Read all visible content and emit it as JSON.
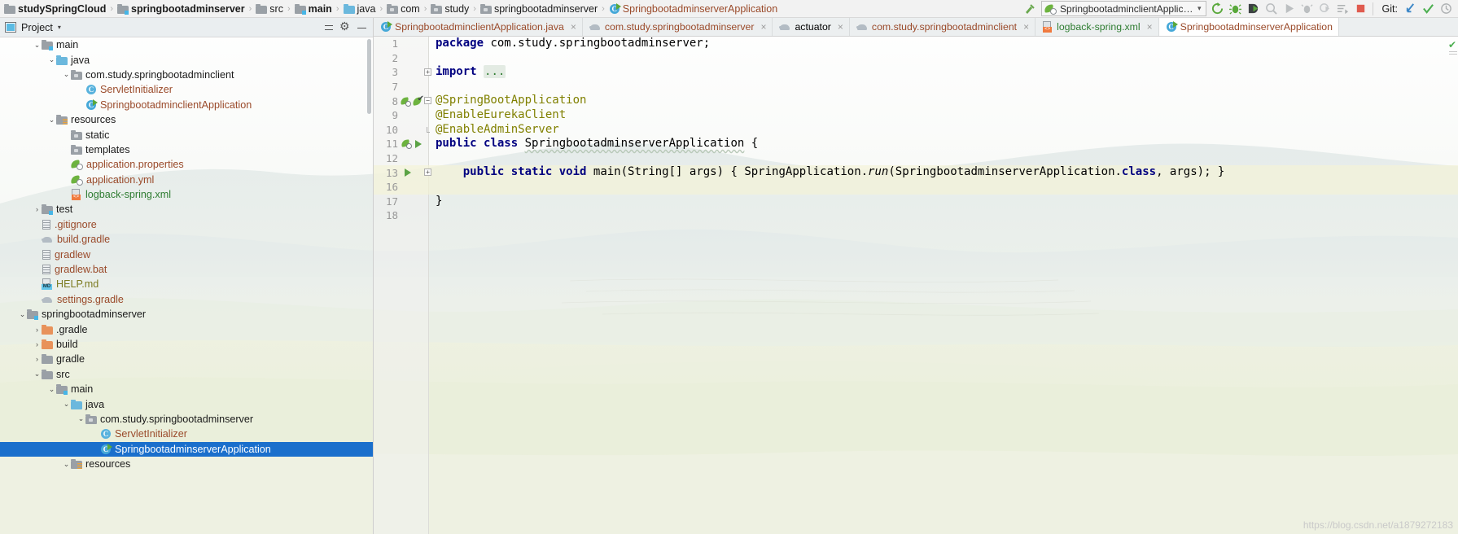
{
  "navbar": {
    "breadcrumbs": [
      {
        "label": "studySpringCloud",
        "icon": "project-icon",
        "style": "bold"
      },
      {
        "label": "springbootadminserver",
        "icon": "module-folder-icon",
        "style": "bold"
      },
      {
        "label": "src",
        "icon": "folder-icon",
        "style": "normal"
      },
      {
        "label": "main",
        "icon": "source-folder-icon",
        "style": "bold"
      },
      {
        "label": "java",
        "icon": "java-folder-icon",
        "style": "normal"
      },
      {
        "label": "com",
        "icon": "package-icon",
        "style": "normal"
      },
      {
        "label": "study",
        "icon": "package-icon",
        "style": "normal"
      },
      {
        "label": "springbootadminserver",
        "icon": "package-icon",
        "style": "normal"
      },
      {
        "label": "SpringbootadminserverApplication",
        "icon": "spring-class-icon",
        "style": "class"
      }
    ],
    "separator": "›",
    "build_icon": "hammer-icon",
    "run_config": {
      "icon": "spring-boot-icon",
      "label": "SpringbootadminclientApplication",
      "chevron": "▾"
    },
    "toolbar_icons": [
      "rerun-icon",
      "debug-icon",
      "run-with-coverage-icon",
      "profile-icon",
      "run-icon",
      "attach-icon",
      "coverage-icon",
      "run-dashboard-icon",
      "stop-icon"
    ],
    "git_label": "Git:",
    "git_icons": [
      "update-project-icon",
      "commit-icon",
      "history-icon"
    ]
  },
  "sidebar": {
    "title": "Project",
    "caret": "▾",
    "header_icons": [
      "collapse-all-icon",
      "settings-gear-icon",
      "hide-icon"
    ],
    "tree": [
      {
        "depth": 2,
        "arrow": "⌄",
        "icon": "source-folder-icon",
        "label": "main",
        "color": "default"
      },
      {
        "depth": 3,
        "arrow": "⌄",
        "icon": "java-folder-icon",
        "label": "java",
        "color": "default"
      },
      {
        "depth": 4,
        "arrow": "⌄",
        "icon": "package-icon",
        "label": "com.study.springbootadminclient",
        "color": "default"
      },
      {
        "depth": 5,
        "arrow": "",
        "icon": "class-icon",
        "label": "ServletInitializer",
        "color": "java"
      },
      {
        "depth": 5,
        "arrow": "",
        "icon": "spring-class-icon",
        "label": "SpringbootadminclientApplication",
        "color": "java"
      },
      {
        "depth": 3,
        "arrow": "⌄",
        "icon": "resources-folder-icon",
        "label": "resources",
        "color": "default"
      },
      {
        "depth": 4,
        "arrow": "",
        "icon": "package-icon",
        "label": "static",
        "color": "default"
      },
      {
        "depth": 4,
        "arrow": "",
        "icon": "package-icon",
        "label": "templates",
        "color": "default"
      },
      {
        "depth": 4,
        "arrow": "",
        "icon": "spring-config-icon",
        "label": "application.properties",
        "color": "java"
      },
      {
        "depth": 4,
        "arrow": "",
        "icon": "spring-config-icon",
        "label": "application.yml",
        "color": "java"
      },
      {
        "depth": 4,
        "arrow": "",
        "icon": "xml-file-icon",
        "label": "logback-spring.xml",
        "color": "green"
      },
      {
        "depth": 2,
        "arrow": "›",
        "icon": "test-folder-icon",
        "label": "test",
        "color": "default"
      },
      {
        "depth": 2,
        "arrow": "",
        "icon": "file-icon",
        "label": ".gitignore",
        "color": "java"
      },
      {
        "depth": 2,
        "arrow": "",
        "icon": "gradle-icon",
        "label": "build.gradle",
        "color": "java"
      },
      {
        "depth": 2,
        "arrow": "",
        "icon": "file-icon",
        "label": "gradlew",
        "color": "java"
      },
      {
        "depth": 2,
        "arrow": "",
        "icon": "file-icon",
        "label": "gradlew.bat",
        "color": "java"
      },
      {
        "depth": 2,
        "arrow": "",
        "icon": "markdown-icon",
        "label": "HELP.md",
        "color": "olive"
      },
      {
        "depth": 2,
        "arrow": "",
        "icon": "gradle-icon",
        "label": "settings.gradle",
        "color": "java"
      },
      {
        "depth": 1,
        "arrow": "⌄",
        "icon": "module-folder-icon",
        "label": "springbootadminserver",
        "color": "default"
      },
      {
        "depth": 2,
        "arrow": "›",
        "icon": "excluded-folder-icon",
        "label": ".gradle",
        "color": "default"
      },
      {
        "depth": 2,
        "arrow": "›",
        "icon": "excluded-folder-icon",
        "label": "build",
        "color": "default"
      },
      {
        "depth": 2,
        "arrow": "›",
        "icon": "folder-icon",
        "label": "gradle",
        "color": "default"
      },
      {
        "depth": 2,
        "arrow": "⌄",
        "icon": "folder-icon",
        "label": "src",
        "color": "default"
      },
      {
        "depth": 3,
        "arrow": "⌄",
        "icon": "source-folder-icon",
        "label": "main",
        "color": "default"
      },
      {
        "depth": 4,
        "arrow": "⌄",
        "icon": "java-folder-icon",
        "label": "java",
        "color": "default"
      },
      {
        "depth": 5,
        "arrow": "⌄",
        "icon": "package-icon",
        "label": "com.study.springbootadminserver",
        "color": "default"
      },
      {
        "depth": 6,
        "arrow": "",
        "icon": "class-icon",
        "label": "ServletInitializer",
        "color": "java"
      },
      {
        "depth": 6,
        "arrow": "",
        "icon": "spring-class-icon",
        "label": "SpringbootadminserverApplication",
        "color": "java",
        "selected": true
      },
      {
        "depth": 4,
        "arrow": "⌄",
        "icon": "resources-folder-icon",
        "label": "resources",
        "color": "default"
      }
    ]
  },
  "editor": {
    "tabs": [
      {
        "label": "SpringbootadminclientApplication.java",
        "icon": "spring-class-icon",
        "color": "java",
        "active": false,
        "close": "×"
      },
      {
        "label": "com.study.springbootadminserver",
        "icon": "gradle-icon",
        "color": "java",
        "active": false,
        "close": "×"
      },
      {
        "label": "actuator",
        "icon": "gradle-icon",
        "color": "dark",
        "active": false,
        "close": "×"
      },
      {
        "label": "com.study.springbootadminclient",
        "icon": "gradle-icon",
        "color": "java",
        "active": false,
        "close": "×"
      },
      {
        "label": "logback-spring.xml",
        "icon": "xml-file-icon",
        "color": "green",
        "active": false,
        "close": "×"
      },
      {
        "label": "SpringbootadminserverApplication",
        "icon": "spring-class-icon",
        "color": "java",
        "active": true,
        "close": ""
      }
    ],
    "lines": [
      {
        "num": "1",
        "html": "<span class=\"kw\">package</span> com.study.springbootadminserver;",
        "gutter": "",
        "fold": ""
      },
      {
        "num": "2",
        "html": "",
        "gutter": "",
        "fold": ""
      },
      {
        "num": "3",
        "html": "<span class=\"kw\">import</span> <span class=\"fold\">...</span>",
        "gutter": "",
        "fold": "plus"
      },
      {
        "num": "7",
        "html": "",
        "gutter": "",
        "fold": ""
      },
      {
        "num": "8",
        "html": "<span class=\"ann\">@SpringBootApplication</span>",
        "gutter": "bean",
        "fold": "minus"
      },
      {
        "num": "9",
        "html": "<span class=\"ann\">@EnableEurekaClient</span>",
        "gutter": "",
        "fold": ""
      },
      {
        "num": "10",
        "html": "<span class=\"ann\">@EnableAdminServer</span>",
        "gutter": "",
        "fold": "end"
      },
      {
        "num": "11",
        "html": "<span class=\"kw\">public</span> <span class=\"kw\">class</span> <span class=\"squig\">SpringbootadminserverApplication</span> {",
        "gutter": "springrun",
        "fold": ""
      },
      {
        "num": "12",
        "html": "",
        "gutter": "",
        "fold": ""
      },
      {
        "num": "13",
        "html": "    <span class=\"kw\">public</span> <span class=\"kw\">static</span> <span class=\"kw\">void</span> main(String[] args) { SpringApplication.<span class=\"ital\">run</span>(SpringbootadminserverApplication.<span class=\"kw\">class</span>, args); }",
        "gutter": "run",
        "fold": "plus",
        "highlight": true
      },
      {
        "num": "16",
        "html": "",
        "gutter": "",
        "fold": "",
        "highlight": true
      },
      {
        "num": "17",
        "html": "}",
        "gutter": "",
        "fold": ""
      },
      {
        "num": "18",
        "html": "",
        "gutter": "",
        "fold": ""
      }
    ],
    "inspection_status": "✔"
  },
  "watermark": "https://blog.csdn.net/a1879272183"
}
